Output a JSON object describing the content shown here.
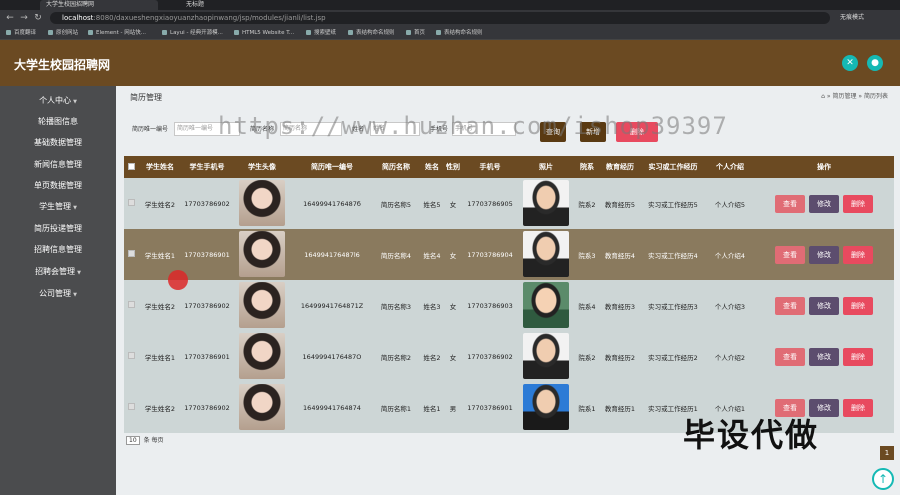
{
  "browser": {
    "tabs": [
      {
        "label": "大学生校园招聘网",
        "active": true
      },
      {
        "label": "无标题",
        "active": false
      }
    ],
    "url_host": "localhost",
    "url_path": ":8080/daxueshengxiaoyuanzhaopinwang/jsp/modules/jianli/list.jsp",
    "profile_label": "无痕模式",
    "bookmarks": [
      "百度翻译",
      "原创网站",
      "Element - 网站快...",
      "Layui - 经典开源模...",
      "HTML5 Website T...",
      "搜索壁纸",
      "表结构命名规则",
      "首页",
      "表结构命名规则"
    ]
  },
  "app": {
    "title": "大学生校园招聘网",
    "header_icons": [
      "expand-icon",
      "user-icon"
    ]
  },
  "sidebar": {
    "items": [
      {
        "label": "个人中心"
      },
      {
        "label": "轮播图信息"
      },
      {
        "label": "基础数据管理"
      },
      {
        "label": "新闻信息管理"
      },
      {
        "label": "单页数据管理"
      },
      {
        "label": "学生管理"
      },
      {
        "label": "简历投递管理"
      },
      {
        "label": "招聘信息管理"
      },
      {
        "label": "招聘会管理"
      },
      {
        "label": "公司管理"
      }
    ]
  },
  "main": {
    "page_title": "简历管理",
    "breadcrumb": {
      "home_icon": "⌂",
      "sep": "»",
      "section": "简历管理",
      "current": "简历列表"
    },
    "filters": [
      {
        "label": "简历唯一编号",
        "placeholder": "简历唯一编号"
      },
      {
        "label": "简历名称",
        "placeholder": "简历名称"
      },
      {
        "label": "姓名",
        "placeholder": "姓名"
      },
      {
        "label": "手机号",
        "placeholder": "手机号"
      }
    ],
    "buttons": {
      "search": "查询",
      "add": "新增",
      "delete": "删除"
    },
    "table": {
      "headers": [
        "学生姓名",
        "学生手机号",
        "学生头像",
        "简历唯一编号",
        "简历名称",
        "姓名",
        "性别",
        "手机号",
        "照片",
        "院系",
        "教育经历",
        "实习或工作经历",
        "个人介绍",
        "操作"
      ],
      "rows": [
        {
          "student_name": "学生姓名2",
          "student_phone": "17703786902",
          "resume_no": "1649994176487б",
          "resume_name": "简历名称5",
          "name": "姓名5",
          "gender": "女",
          "phone": "17703786905",
          "dept": "院系2",
          "edu": "教育经历5",
          "exp": "实习或工作经历5",
          "intro": "个人介绍5"
        },
        {
          "student_name": "学生姓名1",
          "student_phone": "17703786901",
          "resume_no": "164994176487l6",
          "resume_name": "简历名称4",
          "name": "姓名4",
          "gender": "女",
          "phone": "17703786904",
          "dept": "院系3",
          "edu": "教育经历4",
          "exp": "实习或工作经历4",
          "intro": "个人介绍4"
        },
        {
          "student_name": "学生姓名2",
          "student_phone": "17703786902",
          "resume_no": "16499941764871Z",
          "resume_name": "简历名称3",
          "name": "姓名3",
          "gender": "女",
          "phone": "17703786903",
          "dept": "院系4",
          "edu": "教育经历3",
          "exp": "实习或工作经历3",
          "intro": "个人介绍3"
        },
        {
          "student_name": "学生姓名1",
          "student_phone": "17703786901",
          "resume_no": "1649994176487O",
          "resume_name": "简历名称2",
          "name": "姓名2",
          "gender": "女",
          "phone": "17703786902",
          "dept": "院系2",
          "edu": "教育经历2",
          "exp": "实习或工作经历2",
          "intro": "个人介绍2"
        },
        {
          "student_name": "学生姓名2",
          "student_phone": "17703786902",
          "resume_no": "16499941764874",
          "resume_name": "简历名称1",
          "name": "姓名1",
          "gender": "男",
          "phone": "17703786901",
          "dept": "院系1",
          "edu": "教育经历1",
          "exp": "实习或工作经历1",
          "intro": "个人介绍1"
        }
      ],
      "actions": {
        "view": "查看",
        "edit": "修改",
        "del": "删除"
      }
    },
    "pager": {
      "page_size": "10",
      "suffix": "条 每页",
      "current_page": "1"
    }
  },
  "overlays": {
    "watermark": "https://www.huzhan.com/ishop39397",
    "promo": "毕设代做"
  },
  "colors": {
    "brand": "#6b4a22",
    "accent": "#15b9b4",
    "view": "#e06c75",
    "edit": "#5c4d6e",
    "delete": "#e84a5f"
  }
}
